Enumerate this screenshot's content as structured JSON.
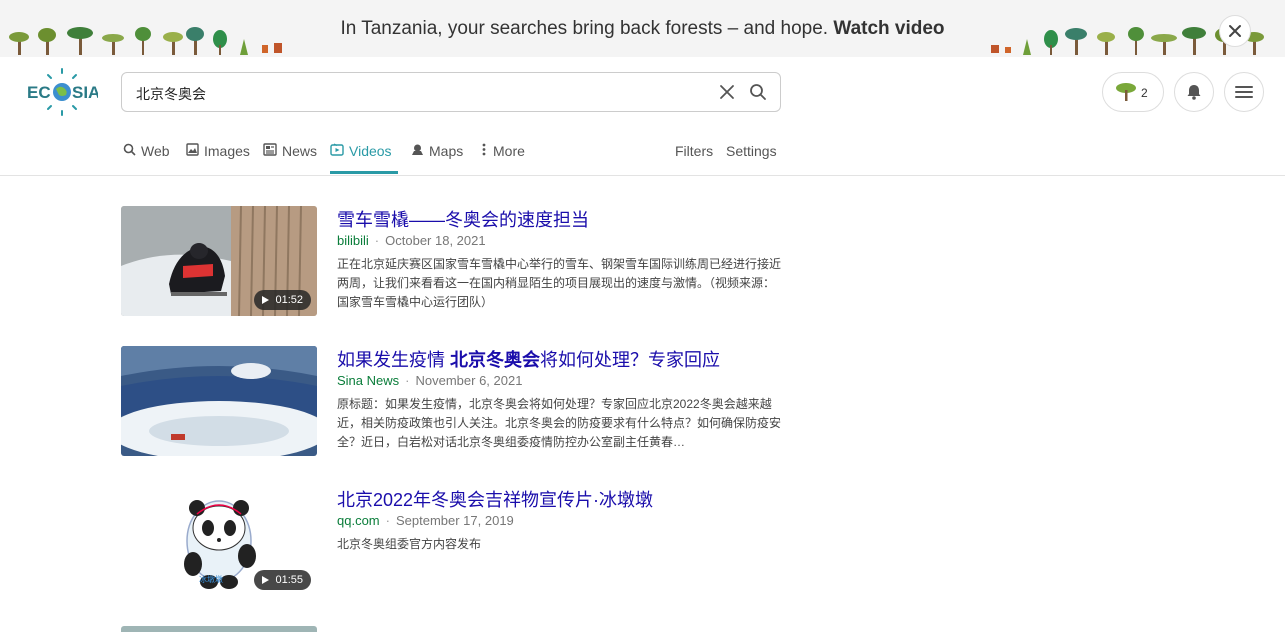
{
  "banner": {
    "text": "In Tanzania, your searches bring back forests – and hope.",
    "link": "Watch video"
  },
  "logo": {
    "alt": "ECOSIA"
  },
  "search": {
    "value": "北京冬奥会"
  },
  "header": {
    "tree_count": "2"
  },
  "tabs": [
    {
      "label": "Web",
      "icon": "search-icon"
    },
    {
      "label": "Images",
      "icon": "image-icon"
    },
    {
      "label": "News",
      "icon": "news-icon"
    },
    {
      "label": "Videos",
      "icon": "video-icon",
      "active": true
    },
    {
      "label": "Maps",
      "icon": "map-pin-icon"
    },
    {
      "label": "More",
      "icon": "more-vertical-icon"
    }
  ],
  "filters_label": "Filters",
  "settings_label": "Settings",
  "results": [
    {
      "title": "雪车雪橇——冬奥会的速度担当",
      "source": "bilibili",
      "date": "October 18, 2021",
      "desc": "正在北京延庆赛区国家雪车雪橇中心举行的雪车、钢架雪车国际训练周已经进行接近两周，让我们来看看这一在国内稍显陌生的项目展现出的速度与激情。（视频来源：国家雪车雪橇中心运行团队）",
      "duration": "01:52"
    },
    {
      "title_pre": "如果发生疫情 ",
      "title_bold": "北京冬奥会",
      "title_post": "将如何处理？专家回应",
      "source": "Sina News",
      "date": "November 6, 2021",
      "desc": "原标题：如果发生疫情，北京冬奥会将如何处理？专家回应北京2022冬奥会越来越近，相关防疫政策也引人关注。北京冬奥会的防疫要求有什么特点？如何确保防疫安全？近日，白岩松对话北京冬奥组委疫情防控办公室副主任黄春…"
    },
    {
      "title": "北京2022年冬奥会吉祥物宣传片·冰墩墩",
      "source": "qq.com",
      "date": "September 17, 2019",
      "desc": "北京冬奥组委官方内容发布",
      "duration": "01:55",
      "thumb_caption": "冰墩墩"
    }
  ],
  "colors": {
    "accent": "#2a9aa6",
    "title_link": "#1a0dab",
    "source": "#0a7d3a"
  }
}
